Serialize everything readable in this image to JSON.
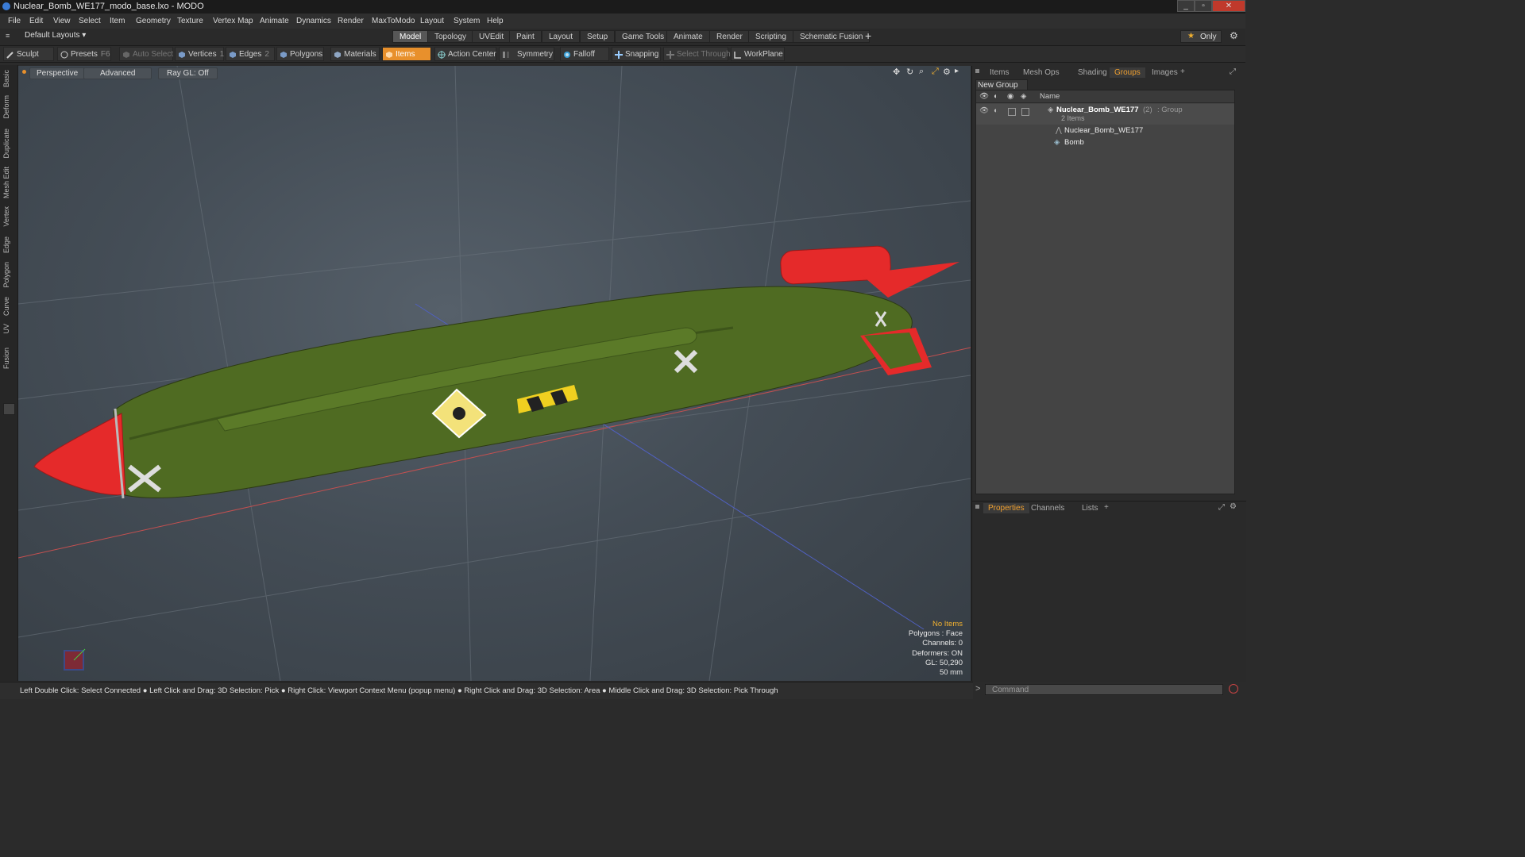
{
  "window": {
    "title": "Nuclear_Bomb_WE177_modo_base.lxo - MODO",
    "controls": [
      "_",
      "▫",
      "✕"
    ]
  },
  "menu": [
    "File",
    "Edit",
    "View",
    "Select",
    "Item",
    "Geometry",
    "Texture",
    "Vertex Map",
    "Animate",
    "Dynamics",
    "Render",
    "MaxToModo",
    "Layout",
    "System",
    "Help"
  ],
  "layout_bar": {
    "layout_selector": "Default Layouts ▾",
    "tabs": [
      "Model",
      "Topology",
      "UVEdit",
      "Paint",
      "Layout",
      "Setup",
      "Game Tools",
      "Animate",
      "Render",
      "Scripting",
      "Schematic Fusion"
    ],
    "active_tab": "Model",
    "add": "+",
    "only": "Only"
  },
  "toolbar": {
    "sculpt": "Sculpt",
    "presets": "Presets",
    "presets_shortcut": "F6",
    "auto_select": "Auto Select",
    "vertices": "Vertices",
    "vertices_count": "1",
    "edges": "Edges",
    "edges_count": "2",
    "polygons": "Polygons",
    "materials": "Materials",
    "items": "Items",
    "action_center": "Action Center",
    "symmetry": "Symmetry",
    "falloff": "Falloff",
    "snapping": "Snapping",
    "select_through": "Select Through",
    "workplane": "WorkPlane"
  },
  "left_tabs": [
    "Basic",
    "Deform",
    "Duplicate",
    "Mesh Edit",
    "Vertex",
    "Edge",
    "Polygon",
    "Curve",
    "UV",
    "Fusion"
  ],
  "viewport": {
    "view": "Perspective",
    "shading": "Advanced",
    "raygl": "Ray GL: Off",
    "info": {
      "items": "No Items",
      "polygons": "Polygons : Face",
      "channels": "Channels: 0",
      "deformers": "Deformers: ON",
      "gl": "GL: 50,290",
      "scale": "50 mm"
    }
  },
  "right_panel": {
    "tabs": [
      "Items",
      "Mesh Ops",
      "Shading",
      "Groups",
      "Images"
    ],
    "active_tab": "Groups",
    "new_group": "New Group",
    "column_name": "Name",
    "group": {
      "name": "Nuclear_Bomb_WE177",
      "count": "(2)",
      "type": ": Group",
      "sub": "2 Items",
      "children": [
        "Nuclear_Bomb_WE177",
        "Bomb"
      ]
    },
    "bottom_tabs": [
      "Properties",
      "Channels",
      "Lists"
    ],
    "bottom_active": "Properties",
    "command_placeholder": "Command"
  },
  "statusbar": {
    "hint": "Left Double Click: Select Connected ● Left Click and Drag: 3D Selection: Pick ● Right Click: Viewport Context Menu (popup menu) ● Right Click and Drag: 3D Selection: Area ● Middle Click and Drag: 3D Selection: Pick Through"
  },
  "colors": {
    "accent": "#e8902c",
    "bomb_body": "#4f6b22",
    "bomb_nose": "#e52a2a"
  }
}
